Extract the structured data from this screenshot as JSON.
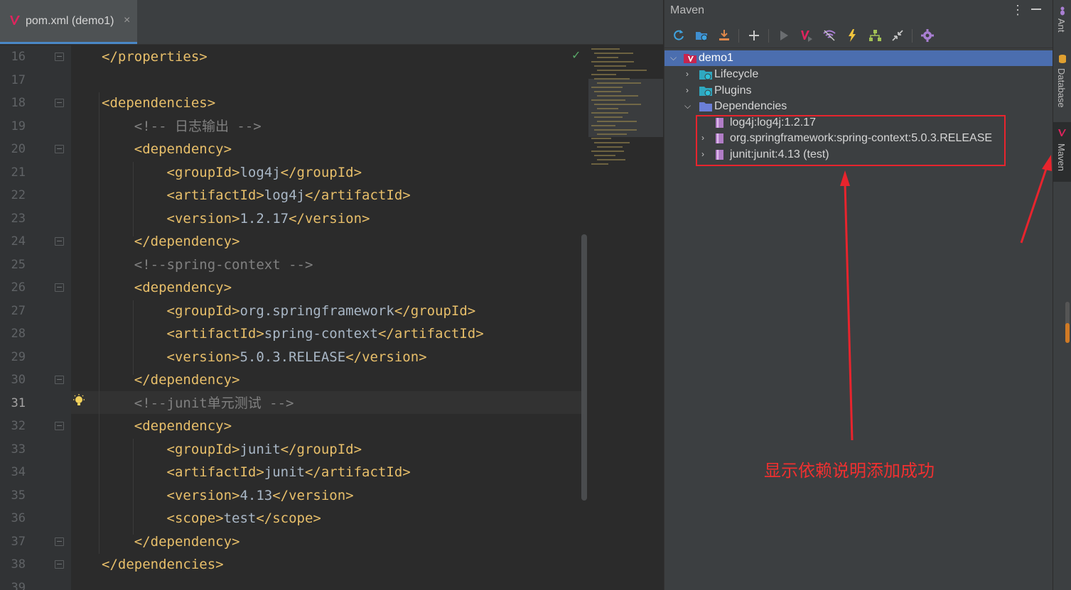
{
  "editor": {
    "tab": {
      "label": "pom.xml (demo1)",
      "close": "×"
    },
    "lines": [
      {
        "n": "16",
        "parts": [
          [
            "tag",
            "</properties>"
          ]
        ]
      },
      {
        "n": "17",
        "parts": []
      },
      {
        "n": "18",
        "parts": [
          [
            "tag",
            "<dependencies>"
          ]
        ]
      },
      {
        "n": "19",
        "parts": [
          [
            "cmt",
            "    <!-- 日志输出 -->"
          ]
        ]
      },
      {
        "n": "20",
        "parts": [
          [
            "tag",
            "    <dependency>"
          ]
        ]
      },
      {
        "n": "21",
        "parts": [
          [
            "tag",
            "        <groupId>"
          ],
          [
            "txt",
            "log4j"
          ],
          [
            "tag",
            "</groupId>"
          ]
        ]
      },
      {
        "n": "22",
        "parts": [
          [
            "tag",
            "        <artifactId>"
          ],
          [
            "txt",
            "log4j"
          ],
          [
            "tag",
            "</artifactId>"
          ]
        ]
      },
      {
        "n": "23",
        "parts": [
          [
            "tag",
            "        <version>"
          ],
          [
            "txt",
            "1.2.17"
          ],
          [
            "tag",
            "</version>"
          ]
        ]
      },
      {
        "n": "24",
        "parts": [
          [
            "tag",
            "    </dependency>"
          ]
        ]
      },
      {
        "n": "25",
        "parts": [
          [
            "cmt",
            "    <!--spring-context -->"
          ]
        ]
      },
      {
        "n": "26",
        "parts": [
          [
            "tag",
            "    <dependency>"
          ]
        ]
      },
      {
        "n": "27",
        "parts": [
          [
            "tag",
            "        <groupId>"
          ],
          [
            "txt",
            "org.springframework"
          ],
          [
            "tag",
            "</groupId>"
          ]
        ]
      },
      {
        "n": "28",
        "parts": [
          [
            "tag",
            "        <artifactId>"
          ],
          [
            "txt",
            "spring-context"
          ],
          [
            "tag",
            "</artifactId>"
          ]
        ]
      },
      {
        "n": "29",
        "parts": [
          [
            "tag",
            "        <version>"
          ],
          [
            "txt",
            "5.0.3.RELEASE"
          ],
          [
            "tag",
            "</version>"
          ]
        ]
      },
      {
        "n": "30",
        "parts": [
          [
            "tag",
            "    </dependency>"
          ]
        ]
      },
      {
        "n": "31",
        "parts": [
          [
            "cmt",
            "    <!--junit单元测试 -->"
          ]
        ]
      },
      {
        "n": "32",
        "parts": [
          [
            "tag",
            "    <dependency>"
          ]
        ]
      },
      {
        "n": "33",
        "parts": [
          [
            "tag",
            "        <groupId>"
          ],
          [
            "txt",
            "junit"
          ],
          [
            "tag",
            "</groupId>"
          ]
        ]
      },
      {
        "n": "34",
        "parts": [
          [
            "tag",
            "        <artifactId>"
          ],
          [
            "txt",
            "junit"
          ],
          [
            "tag",
            "</artifactId>"
          ]
        ]
      },
      {
        "n": "35",
        "parts": [
          [
            "tag",
            "        <version>"
          ],
          [
            "txt",
            "4.13"
          ],
          [
            "tag",
            "</version>"
          ]
        ]
      },
      {
        "n": "36",
        "parts": [
          [
            "tag",
            "        <scope>"
          ],
          [
            "txt",
            "test"
          ],
          [
            "tag",
            "</scope>"
          ]
        ]
      },
      {
        "n": "37",
        "parts": [
          [
            "tag",
            "    </dependency>"
          ]
        ]
      },
      {
        "n": "38",
        "parts": [
          [
            "tag",
            "</dependencies>"
          ]
        ]
      },
      {
        "n": "39",
        "parts": []
      }
    ],
    "current_line": "31",
    "colors": {
      "tag": "#e8bf6a",
      "comment": "#808080",
      "text": "#a9b7c6"
    }
  },
  "maven": {
    "title": "Maven",
    "more": "⋮",
    "toolbar_icons": [
      "reload-icon",
      "generate-sources-icon",
      "download-icon",
      "add-icon",
      "run-icon",
      "execute-goal-icon",
      "toggle-offline-icon",
      "skip-tests-icon",
      "show-dependencies-icon",
      "collapse-all-icon",
      "settings-icon"
    ],
    "tree": {
      "root": "demo1",
      "lifecycle": "Lifecycle",
      "plugins": "Plugins",
      "dependencies": "Dependencies",
      "deps": [
        "log4j:log4j:1.2.17",
        "org.springframework:spring-context:5.0.3.RELEASE",
        "junit:junit:4.13 (test)"
      ]
    },
    "annotation": "显示依赖说明添加成功",
    "annotation_color": "#f03030"
  },
  "strip": {
    "ant": "Ant",
    "database": "Database",
    "maven": "Maven"
  }
}
